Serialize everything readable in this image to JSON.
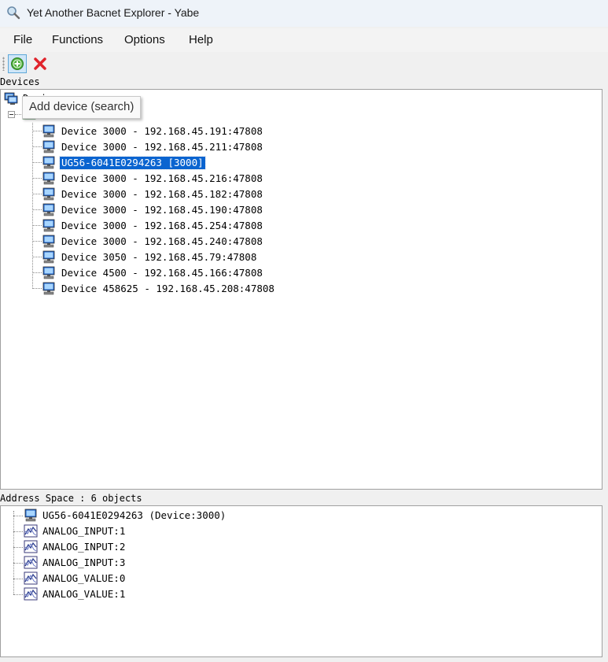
{
  "window": {
    "title": "Yet Another Bacnet Explorer - Yabe"
  },
  "menu": {
    "file": "File",
    "functions": "Functions",
    "options": "Options",
    "help": "Help"
  },
  "toolbar": {
    "add_tooltip": "Add device (search)"
  },
  "devices": {
    "label": "Devices",
    "root_label": "Devices",
    "items": [
      "Device 3000 - 192.168.45.191:47808",
      "Device 3000 - 192.168.45.211:47808",
      "UG56-6041E0294263 [3000]",
      "Device 3000 - 192.168.45.216:47808",
      "Device 3000 - 192.168.45.182:47808",
      "Device 3000 - 192.168.45.190:47808",
      "Device 3000 - 192.168.45.254:47808",
      "Device 3000 - 192.168.45.240:47808",
      "Device 3050 - 192.168.45.79:47808",
      "Device 4500 - 192.168.45.166:47808",
      "Device 458625 - 192.168.45.208:47808"
    ],
    "selected_index": 2
  },
  "address_space": {
    "label": "Address Space : 6 objects",
    "items": [
      "UG56-6041E0294263 (Device:3000)",
      "ANALOG_INPUT:1",
      "ANALOG_INPUT:2",
      "ANALOG_INPUT:3",
      "ANALOG_VALUE:0",
      "ANALOG_VALUE:1"
    ]
  }
}
